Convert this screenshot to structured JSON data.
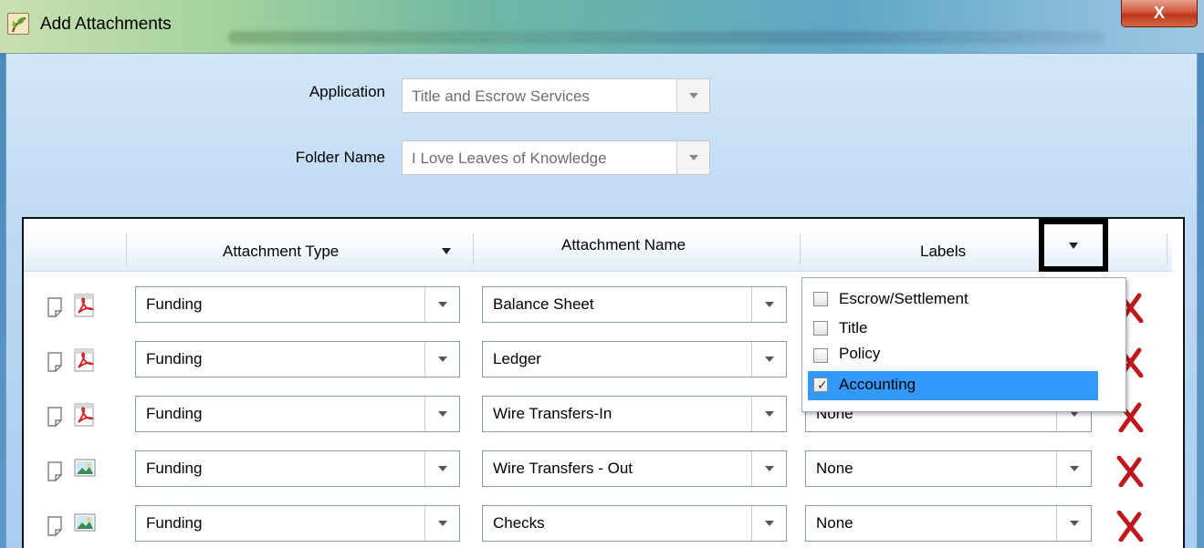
{
  "window": {
    "title": "Add Attachments",
    "close_label": "X"
  },
  "form": {
    "application_label": "Application",
    "application_value": "Title and Escrow Services",
    "folder_label": "Folder Name",
    "folder_value": "I Love Leaves of Knowledge"
  },
  "grid": {
    "columns": {
      "type": "Attachment Type",
      "name": "Attachment Name",
      "labels": "Labels"
    },
    "rows": [
      {
        "file_icon": "pdf-icon",
        "type": "Funding",
        "name": "Balance Sheet",
        "labels": ""
      },
      {
        "file_icon": "pdf-icon",
        "type": "Funding",
        "name": "Ledger",
        "labels": ""
      },
      {
        "file_icon": "pdf-icon",
        "type": "Funding",
        "name": "Wire Transfers-In",
        "labels": "None"
      },
      {
        "file_icon": "image-icon",
        "type": "Funding",
        "name": "Wire Transfers - Out",
        "labels": "None"
      },
      {
        "file_icon": "image-icon",
        "type": "Funding",
        "name": "Checks",
        "labels": "None"
      }
    ]
  },
  "labels_dropdown": {
    "options": [
      {
        "label": "Escrow/Settlement",
        "checked": false
      },
      {
        "label": "Title",
        "checked": false
      },
      {
        "label": "Policy",
        "checked": false
      },
      {
        "label": "Accounting",
        "checked": true
      }
    ],
    "highlighted_index": 3
  },
  "colors": {
    "selection": "#3399ff",
    "delete": "#c0171d",
    "highlight_border": "#000000"
  }
}
